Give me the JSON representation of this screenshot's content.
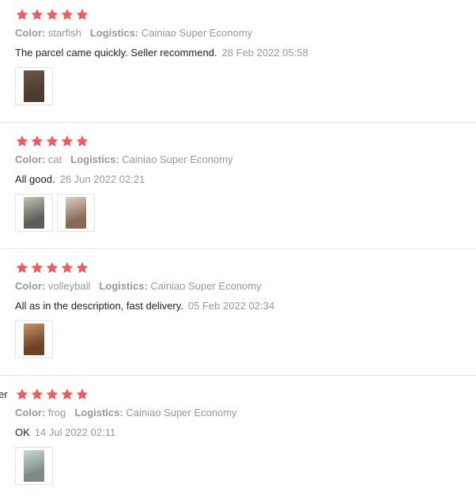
{
  "reviews": [
    {
      "rating": 5,
      "color_label": "Color:",
      "color_value": "starfish",
      "logistics_label": "Logistics:",
      "logistics_value": "Cainiao Super Economy",
      "comment": "The parcel came quickly. Seller recommend.",
      "date": "28 Feb 2022 05:58",
      "photos": [
        {
          "name": "review-photo",
          "colors": [
            "#4a3b30",
            "#6e5545"
          ]
        }
      ]
    },
    {
      "rating": 5,
      "color_label": "Color:",
      "color_value": "cat",
      "logistics_label": "Logistics:",
      "logistics_value": "Cainiao Super Economy",
      "comment": "All good.",
      "date": "26 Jun 2022 02:21",
      "photos": [
        {
          "name": "review-photo",
          "colors": [
            "#5a5f57",
            "#c9c4b3"
          ]
        },
        {
          "name": "review-photo",
          "colors": [
            "#8a6a55",
            "#d6d1c8"
          ]
        }
      ]
    },
    {
      "rating": 5,
      "color_label": "Color:",
      "color_value": "volleyball",
      "logistics_label": "Logistics:",
      "logistics_value": "Cainiao Super Economy",
      "comment": "All as in the description, fast delivery.",
      "date": "05 Feb 2022 02:34",
      "photos": [
        {
          "name": "review-photo",
          "colors": [
            "#6b4327",
            "#c79264"
          ]
        }
      ]
    },
    {
      "rating": 5,
      "color_label": "Color:",
      "color_value": "frog",
      "logistics_label": "Logistics:",
      "logistics_value": "Cainiao Super Economy",
      "comment": "OK",
      "date": "14 Jul 2022 02:11",
      "photos": [
        {
          "name": "review-photo",
          "colors": [
            "#7d8b86",
            "#cfd8d6"
          ]
        }
      ]
    }
  ],
  "partial_left_text": "er",
  "star_color": "#f15b5b"
}
